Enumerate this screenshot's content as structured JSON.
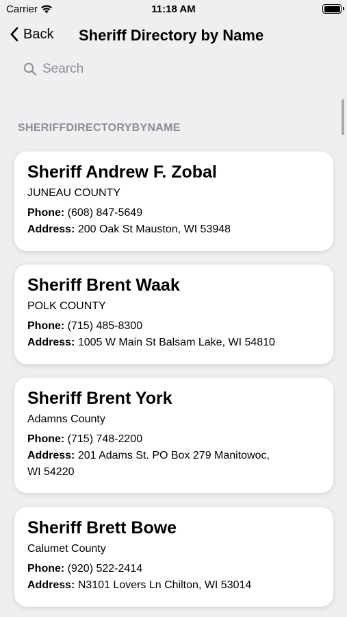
{
  "status": {
    "carrier": "Carrier",
    "time": "11:18 AM"
  },
  "nav": {
    "back_label": "Back",
    "title": "Sheriff Directory by Name"
  },
  "search": {
    "placeholder": "Search"
  },
  "section": {
    "header": "SHERIFFDIRECTORYBYNAME"
  },
  "field_labels": {
    "phone": "Phone:",
    "address": "Address:"
  },
  "cards": [
    {
      "name": "Sheriff Andrew F. Zobal",
      "county": "JUNEAU COUNTY",
      "phone": "(608) 847-5649",
      "address": "200 Oak St Mauston, WI 53948"
    },
    {
      "name": "Sheriff Brent Waak",
      "county": "POLK COUNTY",
      "phone": "(715) 485-8300",
      "address": "1005 W Main St Balsam Lake, WI 54810"
    },
    {
      "name": "Sheriff Brent York",
      "county": "Adamns County",
      "phone": "(715) 748-2200",
      "address_line1": "201 Adams St. PO Box 279 Manitowoc,",
      "address_line2": "WI 54220"
    },
    {
      "name": "Sheriff Brett Bowe",
      "county": "Calumet County",
      "phone": "(920) 522-2414",
      "address": "N3101 Lovers Ln Chilton, WI 53014"
    }
  ]
}
